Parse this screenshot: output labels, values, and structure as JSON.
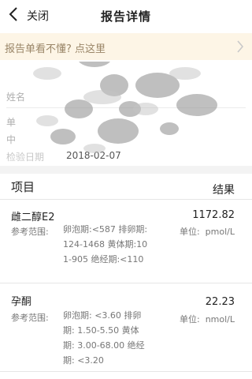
{
  "header": {
    "back_icon": "chevron-left-icon",
    "close_label": "关闭",
    "title": "报告详情"
  },
  "notice": {
    "text": "报告单看不懂? 点这里",
    "chevron_icon": "chevron-right-icon"
  },
  "patient_info": {
    "name_label": "姓名",
    "row2_label": "单",
    "row3_label": "中",
    "date_label": "检验日期",
    "date_value": "2018-02-07"
  },
  "table": {
    "item_header": "项目",
    "result_header": "结果",
    "ref_label": "参考范围:",
    "unit_label": "单位:",
    "rows": [
      {
        "name": "雌二醇E2",
        "value": "1172.82",
        "ref_range": "卵泡期:<587 排卵期:124-1468 黄体期:101-905 绝经期:<110",
        "unit": "pmol/L"
      },
      {
        "name": "孕酮",
        "value": "22.23",
        "ref_range": "卵泡期: <3.60 排卵期: 1.50-5.50 黄体期: 3.00-68.00 绝经期: <3.20",
        "unit": "nmol/L"
      }
    ]
  },
  "colors": {
    "notice_bg": "#fdf5e6",
    "notice_text": "#9a8668",
    "separator": "#f3f3f3"
  }
}
